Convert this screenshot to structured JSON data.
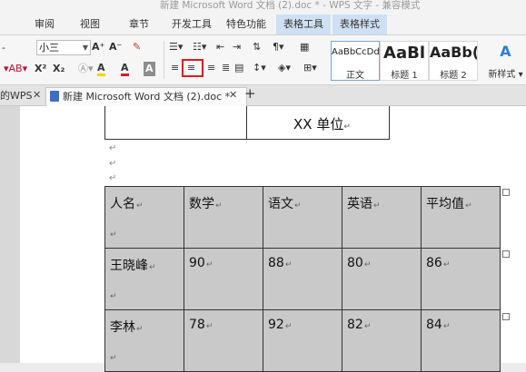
{
  "window": {
    "title": "新建 Microsoft Word 文档 (2).doc * - WPS 文字 - 兼容模式"
  },
  "menu": [
    "审阅",
    "视图",
    "章节",
    "开发工具",
    "特色功能",
    "表格工具",
    "表格样式"
  ],
  "ribbon": {
    "font_size": "小三",
    "grow_font": "A⁺",
    "shrink_font": "A⁻",
    "clear_format": "✎",
    "superscript": "X²",
    "subscript": "X₂",
    "highlight_letter": "A",
    "font_color_letter": "A",
    "shade_letter": "A"
  },
  "styles": [
    {
      "preview": "AaBbCcDd",
      "name": "正文"
    },
    {
      "preview": "AaBl",
      "name": "标题 1"
    },
    {
      "preview": "AaBb(",
      "name": "标题 2"
    },
    {
      "preview": "A",
      "name": "新样式 ▾"
    }
  ],
  "doc_tabs": {
    "home": "的WPS",
    "active": "新建 Microsoft Word 文档 (2).doc *",
    "add": "+"
  },
  "document": {
    "header_title": "XX 单位",
    "para_mark": "↵",
    "table": {
      "headers": [
        "人名",
        "数学",
        "语文",
        "英语",
        "平均值"
      ],
      "rows": [
        [
          "王晓峰",
          "90",
          "88",
          "80",
          "86"
        ],
        [
          "李林",
          "78",
          "92",
          "82",
          "84"
        ]
      ]
    }
  },
  "colors": {
    "accent_tab": "#cfe0f3",
    "selection_box": "#d62020",
    "table_shade": "#c9c9c9"
  }
}
